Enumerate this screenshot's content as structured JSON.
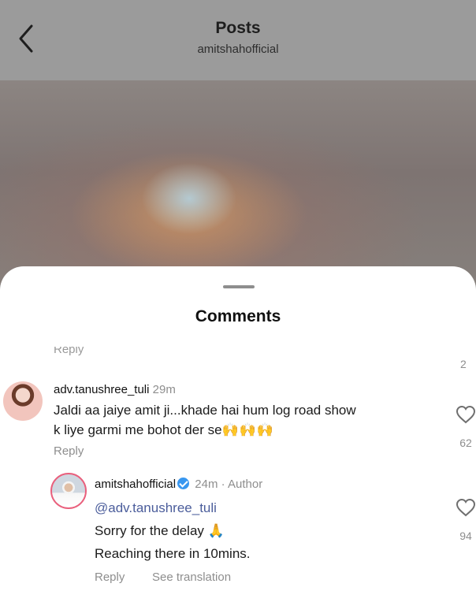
{
  "header": {
    "title": "Posts",
    "subtitle": "amitshahofficial"
  },
  "sheet": {
    "title": "Comments",
    "cut_reply_label": "Reply",
    "top_like_count": "2"
  },
  "comments": [
    {
      "username": "adv.tanushree_tuli",
      "time": "29m",
      "line1": "Jaldi aa jaiye amit ji...khade hai hum log road show",
      "line2": "k liye garmi me bohot der se",
      "emoji": "🙌🙌🙌",
      "reply_label": "Reply",
      "like_count": "62"
    }
  ],
  "reply": {
    "username": "amitshahofficial",
    "verified": true,
    "time": "24m",
    "separator": "·",
    "author_label": "Author",
    "mention": "@adv.tanushree_tuli",
    "line1": "Sorry for the delay",
    "emoji": "🙏",
    "line2": "Reaching there in 10mins.",
    "reply_label": "Reply",
    "see_translation_label": "See translation",
    "like_count": "94"
  },
  "icons": {
    "back": "chevron-left-icon",
    "like": "heart-outline-icon",
    "verified": "verified-badge-icon"
  },
  "colors": {
    "accent_link": "#4b5d9b",
    "verified": "#3897f0",
    "story_ring": "#e95f7c",
    "muted_text": "#8e8e8e"
  }
}
